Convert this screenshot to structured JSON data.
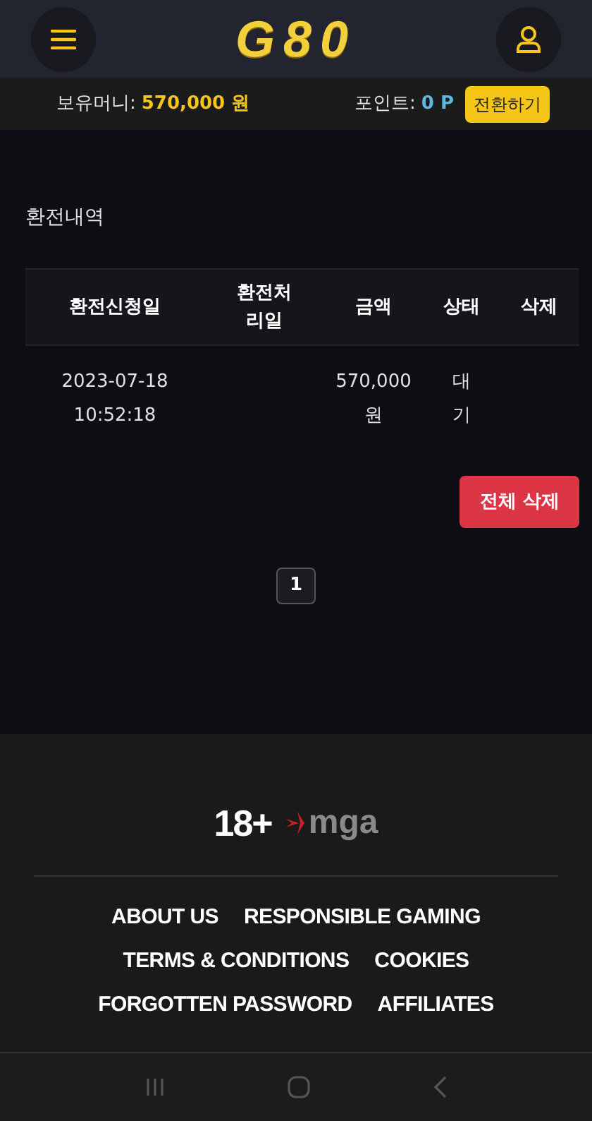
{
  "header": {
    "logo": "G80"
  },
  "balance_bar": {
    "money_label": "보유머니:",
    "money_value": "570,000 원",
    "points_label": "포인트:",
    "points_value": "0 P",
    "convert_button": "전환하기"
  },
  "section_title": "환전내역",
  "table": {
    "columns": [
      "환전신청일",
      "환전처리일",
      "금액",
      "상태",
      "삭제"
    ],
    "rows": [
      [
        "2023-07-18 10:52:18",
        "",
        "570,000 원",
        "대기",
        ""
      ]
    ]
  },
  "delete_all_button": "전체 삭제",
  "pagination": [
    {
      "label": "1",
      "selected": true
    }
  ],
  "footer": {
    "age_badge": "18+",
    "license_logo": "mga",
    "links": [
      "ABOUT US",
      "RESPONSIBLE GAMING",
      "TERMS & CONDITIONS",
      "COOKIES",
      "FORGOTTEN PASSWORD",
      "AFFILIATES"
    ]
  }
}
